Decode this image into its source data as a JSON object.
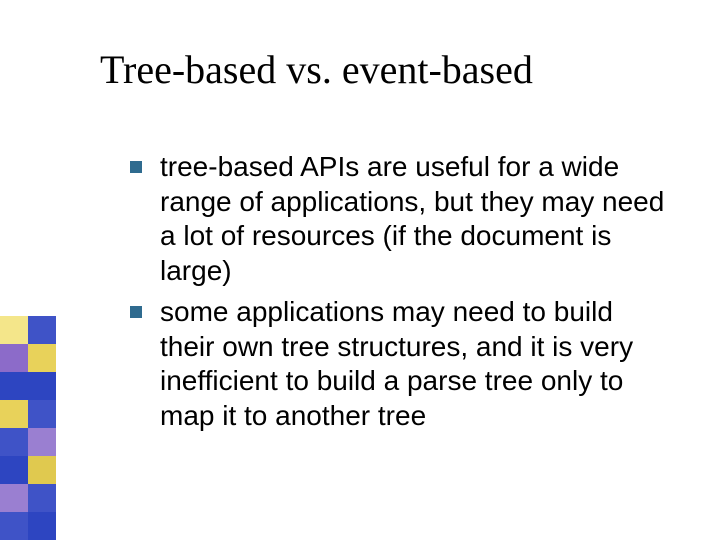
{
  "title": "Tree-based vs. event-based",
  "bullets": [
    "tree-based APIs are useful for a wide range of applications, but they may need a lot of resources (if the document is large)",
    "some applications may need to build their own tree structures, and it is very inefficient to build a parse tree only to map it to another tree"
  ],
  "sidebar_colors": [
    "#f4e68a",
    "#3f53c7",
    "#8c6bc9",
    "#e8d25a",
    "#2d45c1",
    "#2d45c1",
    "#e8d25a",
    "#3f53c7",
    "#3f53c7",
    "#9a7fd1",
    "#2d45c1",
    "#e0c94f",
    "#9a7fd1",
    "#3f53c7",
    "#3f53c7",
    "#2d45c1"
  ]
}
